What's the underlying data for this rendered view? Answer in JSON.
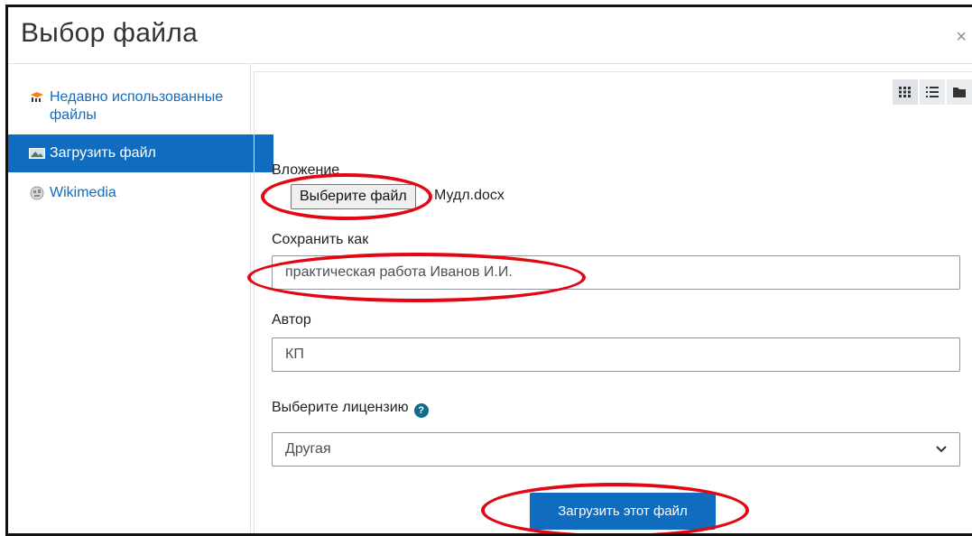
{
  "dialog": {
    "title": "Выбор файла",
    "close_glyph": "×"
  },
  "sidebar": {
    "items": [
      {
        "label": "Недавно использованные файлы",
        "icon": "moodle-logo-icon",
        "active": false
      },
      {
        "label": "Загрузить файл",
        "icon": "upload-icon",
        "active": true
      },
      {
        "label": "Wikimedia",
        "icon": "wikimedia-globe-icon",
        "active": false
      }
    ]
  },
  "view_buttons": [
    "grid-view-icon",
    "list-view-icon",
    "folder-view-icon"
  ],
  "form": {
    "attachment_label": "Вложение",
    "choose_file_button": "Выберите файл",
    "file_name": "Мудл.docx",
    "save_as_label": "Сохранить как",
    "save_as_value": "практическая работа Иванов И.И.",
    "author_label": "Автор",
    "author_value": "КП",
    "license_label": "Выберите лицензию",
    "license_value": "Другая",
    "upload_button": "Загрузить этот файл"
  },
  "colors": {
    "primary": "#0f6cbf",
    "annotation": "#e30613"
  }
}
